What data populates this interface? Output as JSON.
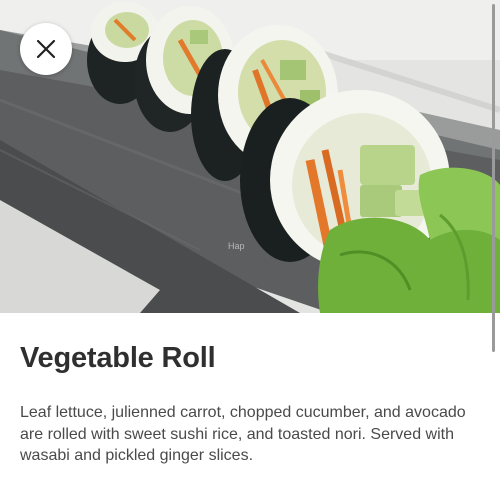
{
  "dish": {
    "name": "Vegetable Roll",
    "description": "Leaf lettuce, julienned carrot, chopped cucumber, and avocado are rolled with sweet sushi rice, and toasted nori. Served with wasabi and pickled ginger slices.",
    "photo_watermark": "Hap"
  },
  "controls": {
    "close_icon": "close-icon"
  },
  "colors": {
    "title": "#2f2f2f",
    "body_text": "#4a4a4a",
    "close_button_bg": "#ffffff"
  }
}
